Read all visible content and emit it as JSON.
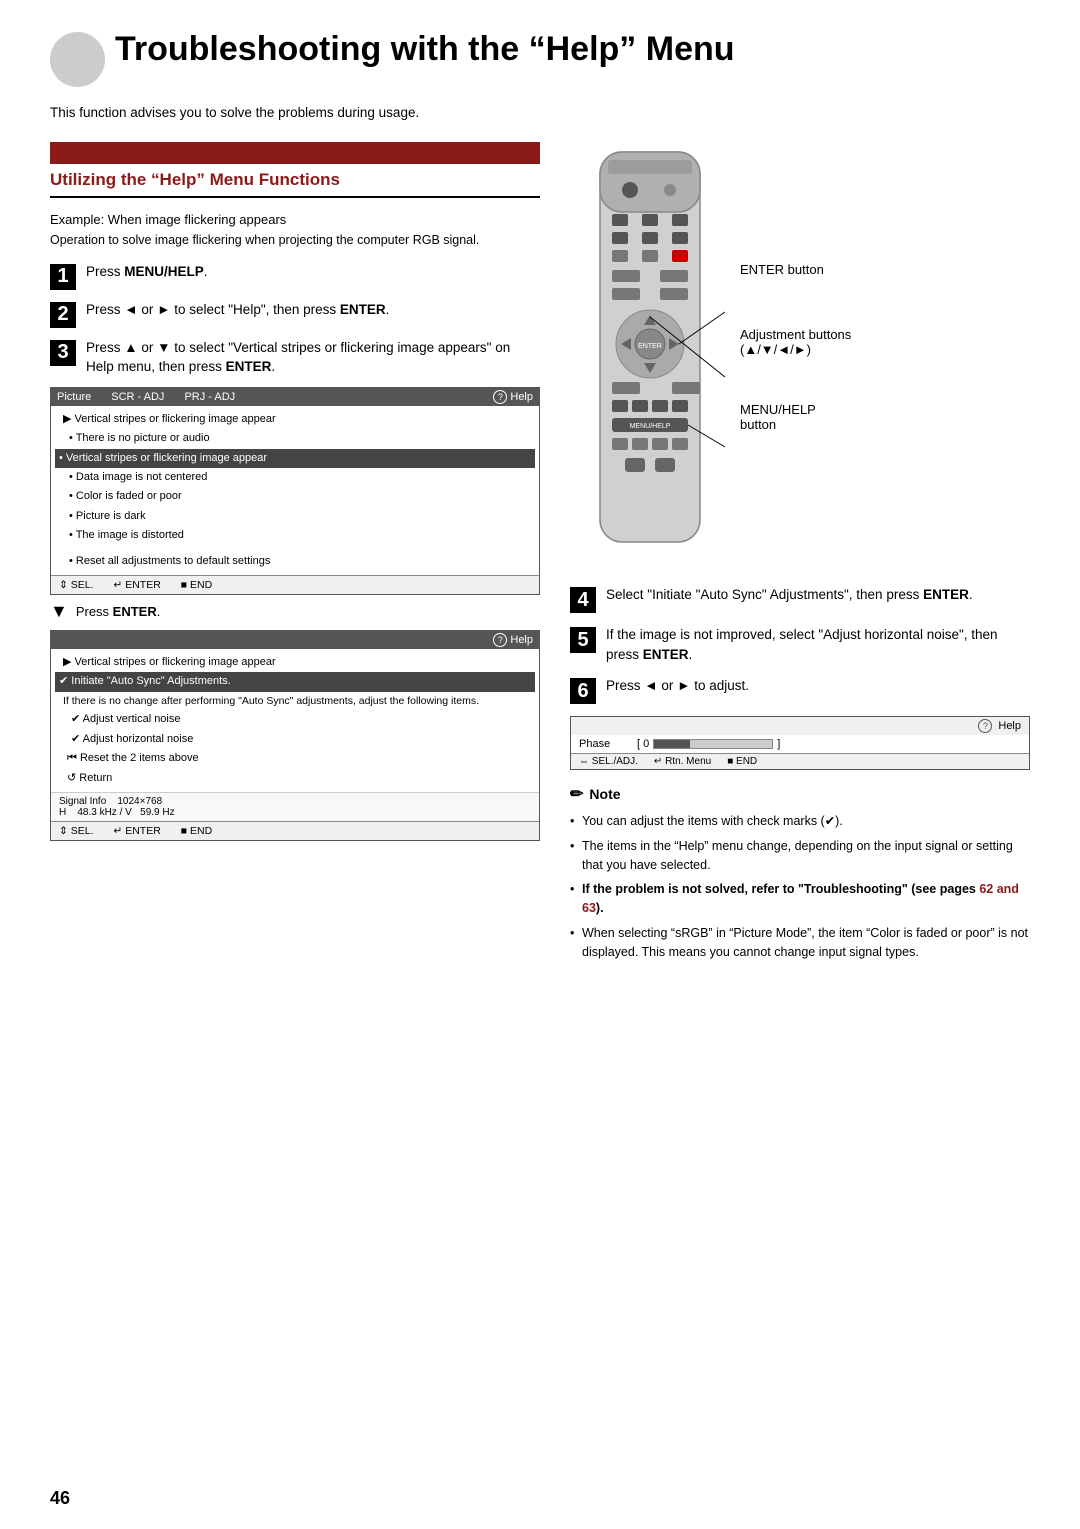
{
  "page": {
    "number": "46",
    "title": "Troubleshooting with the “Help” Menu",
    "intro": "This function advises you to solve the problems during usage."
  },
  "section": {
    "header_bg": "#8B1A1A",
    "title": "Utilizing the “Help” Menu Functions"
  },
  "example": {
    "label": "Example: When image flickering appears",
    "operation": "Operation to solve image flickering when projecting the computer RGB signal."
  },
  "steps_left": [
    {
      "num": "1",
      "text": "Press ",
      "bold": "MENU/HELP",
      "text2": "."
    },
    {
      "num": "2",
      "text": "Press ◄ or ► to select “Help”, then press ",
      "bold": "ENTER",
      "text2": "."
    },
    {
      "num": "3",
      "text": "Press ▲ or ▼ to select “Vertical stripes or flickering image appears” on Help menu, then press ",
      "bold": "ENTER",
      "text2": "."
    }
  ],
  "steps_right": [
    {
      "num": "4",
      "text": "Select “Initiate “Auto Sync” Adjustments”, then press ",
      "bold": "ENTER",
      "text2": "."
    },
    {
      "num": "5",
      "text": "If the image is not improved, select “Adjust horizontal noise”, then press ",
      "bold": "ENTER",
      "text2": "."
    },
    {
      "num": "6",
      "text": "Press ◄ or ► to adjust."
    }
  ],
  "menu1": {
    "headers": [
      "Picture",
      "SCR - ADJ",
      "PRJ - ADJ"
    ],
    "help_label": "Help",
    "items": [
      {
        "type": "arrow",
        "text": "► Vertical stripes or flickering image appear"
      },
      {
        "type": "bullet",
        "text": "There is no picture or audio"
      },
      {
        "type": "highlighted",
        "text": "• Vertical stripes or flickering image appear"
      },
      {
        "type": "bullet",
        "text": "Data image is not centered"
      },
      {
        "type": "bullet",
        "text": "Color is faded or poor"
      },
      {
        "type": "bullet",
        "text": "Picture is dark"
      },
      {
        "type": "bullet",
        "text": "The image is distorted"
      },
      {
        "type": "spacer"
      },
      {
        "type": "bullet",
        "text": "Reset all adjustments to default settings"
      }
    ],
    "footer": [
      "↕ SEL.",
      "↵ ENTER",
      "■ END"
    ]
  },
  "press_enter": {
    "arrow": "↓",
    "label": "Press ",
    "bold": "ENTER"
  },
  "menu2": {
    "help_label": "Help",
    "items": [
      {
        "type": "arrow",
        "text": "► Vertical stripes or flickering image appear"
      },
      {
        "type": "highlighted",
        "text": "✔ Initiate “Auto Sync” Adjustments."
      },
      {
        "type": "normal",
        "text": "If there is no change after performing “Auto Sync” adjustments, adjust the following items."
      },
      {
        "type": "check",
        "text": "✔ Adjust vertical noise"
      },
      {
        "type": "check",
        "text": "✔ Adjust horizontal noise"
      },
      {
        "type": "rewind",
        "text": "⏮ Reset the 2 items above"
      },
      {
        "type": "return",
        "text": "↺ Return"
      }
    ],
    "footer_signal": "Signal Info   1024×768",
    "footer_hz": "H   48.3 kHz / V  59.9 Hz",
    "footer_nav": [
      "↕ SEL.",
      "↵ ENTER",
      "■ END"
    ]
  },
  "phase_box": {
    "help_label": "Help",
    "label": "Phase",
    "value": "0",
    "footer": [
      "↔ SEL./ADJ.",
      "↵ Rtn. Menu",
      "■ END"
    ]
  },
  "remote": {
    "enter_label": "ENTER button",
    "adj_label": "Adjustment buttons",
    "adj_symbols": "(▲/▼/◄/►)",
    "menu_label": "MENU/HELP",
    "menu_sub": "button"
  },
  "notes": [
    "You can adjust the items with check marks (✔).",
    "The items in the “Help” menu change, depending on the input signal or setting that you have selected.",
    "If the problem is not solved, refer to “Troubleshooting” (see pages 62 and 63).",
    "When selecting “sRGB” in “Picture Mode”, the item “Color is faded or poor” is not displayed. This means you cannot change input signal types."
  ],
  "note_bold_3": "If the problem is not solved, refer to “Troubleshooting” (see pages ",
  "note_pages": "62 and 63",
  "note_bold_3_end": ")."
}
